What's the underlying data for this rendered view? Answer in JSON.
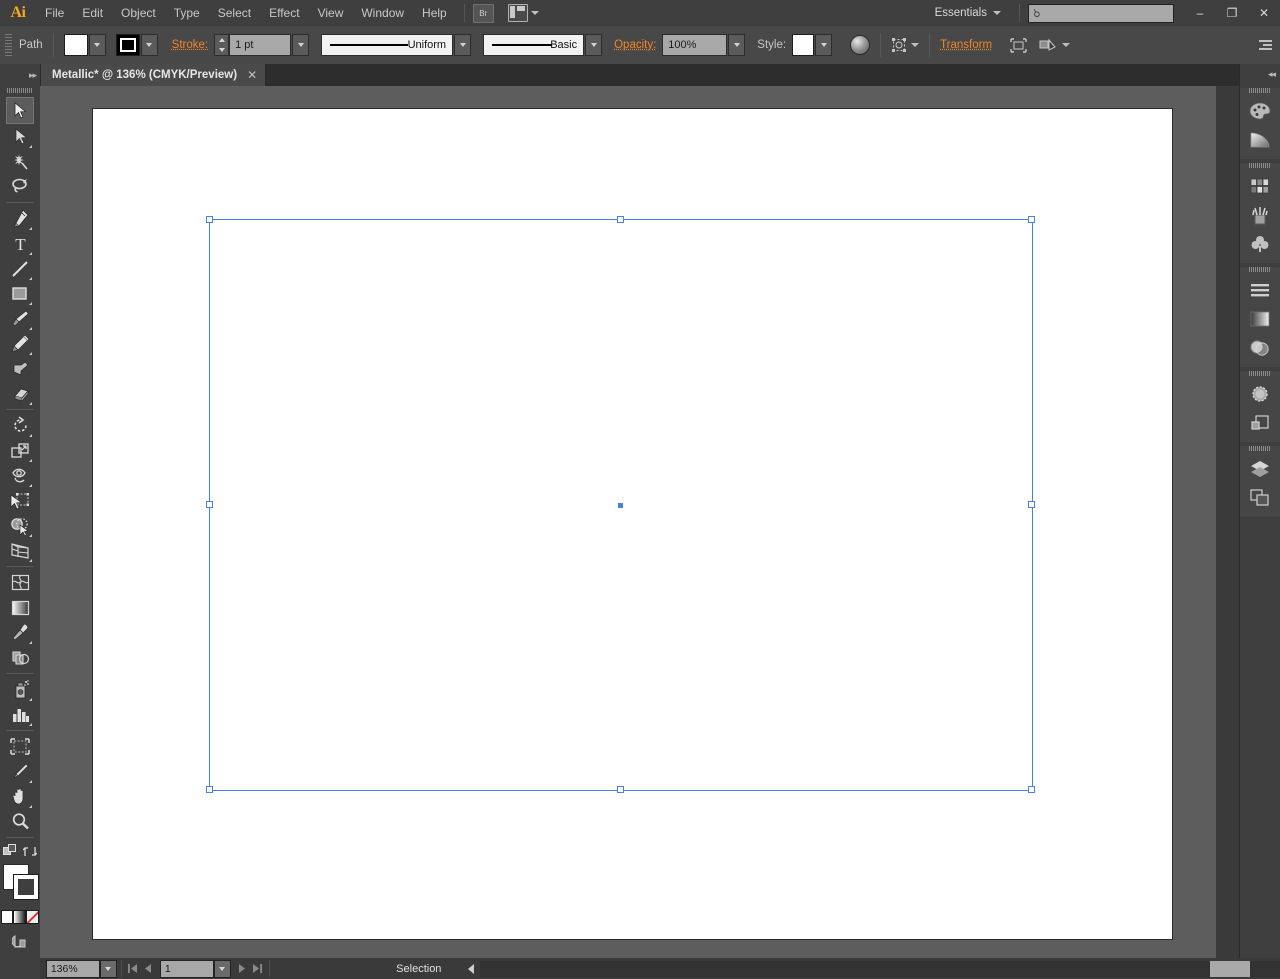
{
  "app": {
    "name": "Adobe Illustrator",
    "logo_text": "Ai"
  },
  "menubar": {
    "items": [
      {
        "label": "File"
      },
      {
        "label": "Edit"
      },
      {
        "label": "Object"
      },
      {
        "label": "Type"
      },
      {
        "label": "Select"
      },
      {
        "label": "Effect"
      },
      {
        "label": "View"
      },
      {
        "label": "Window"
      },
      {
        "label": "Help"
      }
    ],
    "bridge_label": "Br",
    "arrange_icon": "arrange-documents-icon",
    "workspace": "Essentials",
    "search_placeholder": "",
    "window_buttons": {
      "minimize": "–",
      "restore": "❐",
      "close": "✕"
    }
  },
  "controlbar": {
    "object_label": "Path",
    "fill_swatch_color": "#ffffff",
    "stroke_swatch_label": "stroke-color-swatch",
    "stroke_label": "Stroke:",
    "stroke_weight": "1 pt",
    "stroke_profile": "Uniform",
    "brush_definition": "Basic",
    "opacity_label": "Opacity:",
    "opacity_value": "100%",
    "style_label": "Style:",
    "style_swatch_color": "#ffffff",
    "recolor_icon": "recolor-artwork-icon",
    "isolate_icon": "isolate-selected-object-icon",
    "transform_label": "Transform",
    "align_icon": "align-icon",
    "shape_icon": "shape-options-icon",
    "panel_menu_icon": "panel-menu-icon"
  },
  "tabbar": {
    "document_title": "Metallic* @ 136% (CMYK/Preview)",
    "close_glyph": "✕"
  },
  "toolbar": {
    "collapse_glyph": "»",
    "groups": [
      {
        "tools": [
          {
            "name": "selection-tool",
            "active": true,
            "has_flyout": false
          },
          {
            "name": "direct-selection-tool",
            "active": false,
            "has_flyout": true
          },
          {
            "name": "magic-wand-tool",
            "active": false,
            "has_flyout": false
          },
          {
            "name": "lasso-tool",
            "active": false,
            "has_flyout": false
          }
        ]
      },
      {
        "tools": [
          {
            "name": "pen-tool",
            "active": false,
            "has_flyout": true
          },
          {
            "name": "type-tool",
            "active": false,
            "has_flyout": true
          },
          {
            "name": "line-segment-tool",
            "active": false,
            "has_flyout": true
          },
          {
            "name": "rectangle-tool",
            "active": false,
            "has_flyout": true
          },
          {
            "name": "paintbrush-tool",
            "active": false,
            "has_flyout": true
          },
          {
            "name": "pencil-tool",
            "active": false,
            "has_flyout": true
          },
          {
            "name": "blob-brush-tool",
            "active": false,
            "has_flyout": false
          },
          {
            "name": "eraser-tool",
            "active": false,
            "has_flyout": true
          }
        ]
      },
      {
        "tools": [
          {
            "name": "rotate-tool",
            "active": false,
            "has_flyout": true
          },
          {
            "name": "scale-tool",
            "active": false,
            "has_flyout": true
          },
          {
            "name": "width-tool",
            "active": false,
            "has_flyout": true
          },
          {
            "name": "free-transform-tool",
            "active": false,
            "has_flyout": false
          },
          {
            "name": "shape-builder-tool",
            "active": false,
            "has_flyout": true
          },
          {
            "name": "perspective-grid-tool",
            "active": false,
            "has_flyout": true
          }
        ]
      },
      {
        "tools": [
          {
            "name": "mesh-tool",
            "active": false,
            "has_flyout": false
          },
          {
            "name": "gradient-tool",
            "active": false,
            "has_flyout": false
          },
          {
            "name": "eyedropper-tool",
            "active": false,
            "has_flyout": true
          },
          {
            "name": "blend-tool",
            "active": false,
            "has_flyout": false
          }
        ]
      },
      {
        "tools": [
          {
            "name": "symbol-sprayer-tool",
            "active": false,
            "has_flyout": true
          },
          {
            "name": "column-graph-tool",
            "active": false,
            "has_flyout": true
          }
        ]
      },
      {
        "tools": [
          {
            "name": "artboard-tool",
            "active": false,
            "has_flyout": false
          },
          {
            "name": "slice-tool",
            "active": false,
            "has_flyout": true
          },
          {
            "name": "hand-tool",
            "active": false,
            "has_flyout": true
          },
          {
            "name": "zoom-tool",
            "active": false,
            "has_flyout": false
          }
        ]
      }
    ],
    "fill_color": "#ffffff",
    "stroke_color": "#000000",
    "swap_icon": "swap-fill-stroke-icon",
    "default_icon": "default-fill-stroke-icon",
    "color_mode_icons": [
      "color-icon",
      "gradient-icon",
      "none-icon"
    ],
    "screen_mode_icon": "change-screen-mode-icon",
    "drawing_mode_icon": "drawing-modes-icon"
  },
  "canvas": {
    "background_color": "#5d5d5d",
    "artboard_color": "#ffffff",
    "selection_color": "#4a7fe8",
    "selection": {
      "handles": 8,
      "center_point": true
    }
  },
  "dock": {
    "collapse_glyph": "«",
    "groups": [
      {
        "panels": [
          {
            "name": "color-panel-icon"
          },
          {
            "name": "color-guide-panel-icon"
          }
        ]
      },
      {
        "panels": [
          {
            "name": "swatches-panel-icon"
          },
          {
            "name": "brushes-panel-icon"
          },
          {
            "name": "symbols-panel-icon"
          }
        ]
      },
      {
        "panels": [
          {
            "name": "stroke-panel-icon"
          },
          {
            "name": "gradient-panel-icon"
          },
          {
            "name": "transparency-panel-icon"
          }
        ]
      },
      {
        "panels": [
          {
            "name": "appearance-panel-icon"
          },
          {
            "name": "graphic-styles-panel-icon"
          }
        ]
      },
      {
        "panels": [
          {
            "name": "layers-panel-icon"
          },
          {
            "name": "artboards-panel-icon"
          }
        ]
      }
    ]
  },
  "statusbar": {
    "zoom_level": "136%",
    "page_number": "1",
    "status_text": "Selection",
    "first_page_icon": "first-artboard-icon",
    "prev_page_icon": "previous-artboard-icon",
    "next_page_icon": "next-artboard-icon",
    "last_page_icon": "last-artboard-icon"
  }
}
